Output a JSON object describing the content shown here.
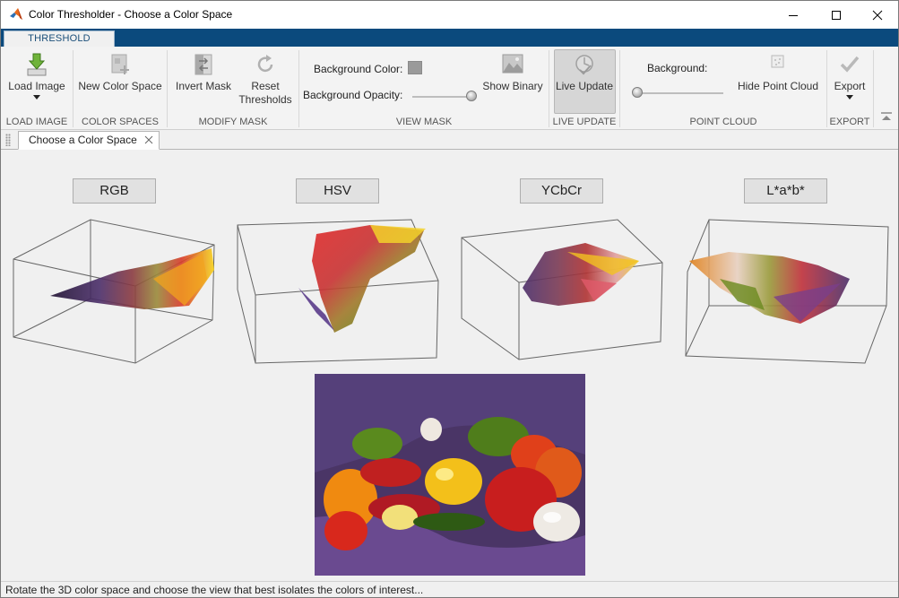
{
  "window": {
    "title": "Color Thresholder - Choose a Color Space"
  },
  "ribbon": {
    "tab": "THRESHOLD",
    "sections": {
      "load_image": "LOAD IMAGE",
      "color_spaces": "COLOR SPACES",
      "modify_mask": "MODIFY MASK",
      "view_mask": "VIEW MASK",
      "live_update": "LIVE UPDATE",
      "point_cloud": "POINT CLOUD",
      "export": "EXPORT"
    },
    "buttons": {
      "load_image": "Load Image",
      "new_color_space": "New Color Space",
      "invert_mask": "Invert Mask",
      "reset_thresholds_line1": "Reset",
      "reset_thresholds_line2": "Thresholds",
      "show_binary": "Show Binary",
      "live_update": "Live Update",
      "hide_point_cloud": "Hide Point Cloud",
      "export": "Export"
    },
    "view_mask": {
      "background_color_label": "Background Color:",
      "background_color": "#9a9a9a",
      "background_opacity_label": "Background Opacity:",
      "background_opacity": 1.0
    },
    "point_cloud": {
      "background_label": "Background:",
      "background_level": 0.0
    }
  },
  "document_tab": {
    "label": "Choose a Color Space"
  },
  "color_spaces": [
    {
      "label": "RGB"
    },
    {
      "label": "HSV"
    },
    {
      "label": "YCbCr"
    },
    {
      "label": "L*a*b*"
    }
  ],
  "status": {
    "text": "Rotate the 3D color space and choose the view that best isolates the colors of interest..."
  },
  "colors": {
    "accent": "#0b4a7d",
    "live_update_active": "#d6d6d6"
  }
}
